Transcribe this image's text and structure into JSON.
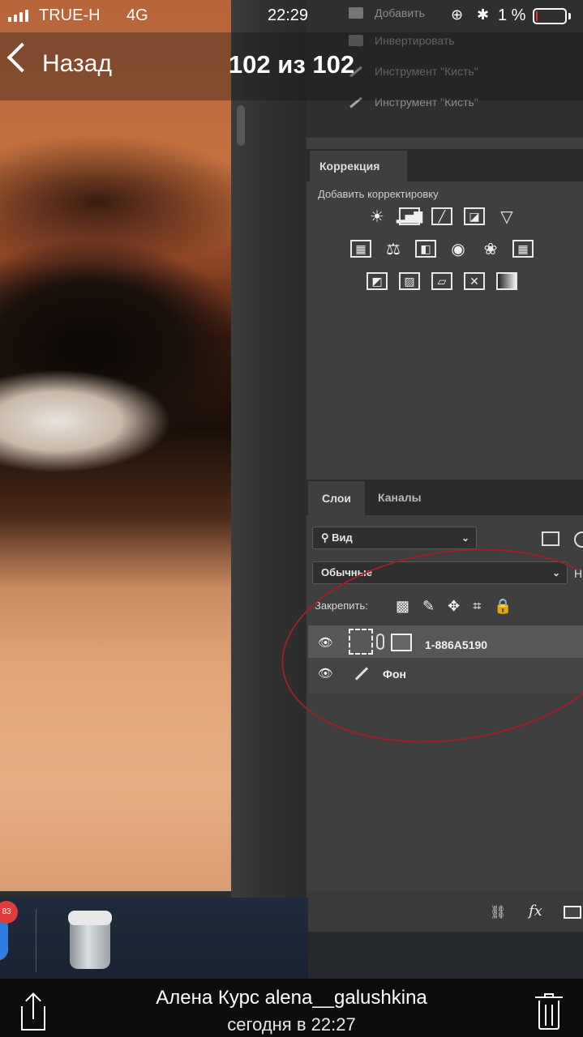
{
  "status_bar": {
    "carrier": "TRUE-H",
    "network": "4G",
    "time": "22:29",
    "battery_percent": "1 %",
    "battery_level": 0.01
  },
  "nav": {
    "back_label": "Назад",
    "title": "102 из 102"
  },
  "photo": {
    "history": {
      "items": [
        "Добавить",
        "Инвертировать",
        "Инструмент \"Кисть\"",
        "Инструмент \"Кисть\""
      ]
    },
    "correction": {
      "tab_label": "Коррекция",
      "subtitle": "Добавить корректировку",
      "rows": [
        [
          "brightness-icon",
          "levels-icon",
          "curves-icon",
          "exposure-icon",
          "gradient-triangle-icon"
        ],
        [
          "vibrance-icon",
          "balance-icon",
          "black-white-icon",
          "photo-filter-icon",
          "channel-mixer-icon",
          "color-lookup-icon"
        ],
        [
          "invert-icon",
          "posterize-icon",
          "threshold-icon",
          "selective-color-icon",
          "gradient-map-icon"
        ]
      ]
    },
    "layers": {
      "tab_layers": "Слои",
      "tab_channels": "Каналы",
      "filter_label": "Вид",
      "blend_mode": "Обычные",
      "trailing_letter": "Н",
      "lock_label": "Закрепить:",
      "layer_list": [
        {
          "name": "1-886A5190"
        },
        {
          "name": "Фон"
        }
      ]
    },
    "dock": {
      "badge": "83"
    },
    "annotation_color": "#9c1f2b"
  },
  "footer": {
    "caption": "Алена Курс alena__galushkina",
    "subcaption": "сегодня в 22:27"
  },
  "colors": {
    "ps_panel": "#3f3f3f",
    "ios_bar": "#0d0d0d"
  }
}
